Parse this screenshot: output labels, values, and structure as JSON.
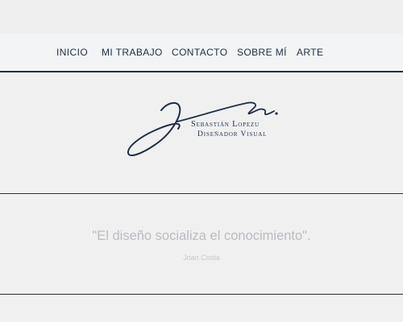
{
  "nav": {
    "items": [
      {
        "label": "INICIO"
      },
      {
        "label": "MI TRABAJO"
      },
      {
        "label": "CONTACTO"
      },
      {
        "label": "SOBRE MÍ"
      },
      {
        "label": "ARTE"
      }
    ]
  },
  "hero": {
    "brand_name": "Sebastián Lopezu",
    "brand_subtitle": "Diseñador Visual",
    "logo_icon": "signature-logo-icon"
  },
  "quote": {
    "text": "\"El diseño socializa el conocimiento\".",
    "author": "Joan Costa"
  },
  "colors": {
    "background": "#f0f0f1",
    "navy": "#1f2f45",
    "divider": "#2a2e34",
    "quote_text": "#b9bcc0"
  }
}
